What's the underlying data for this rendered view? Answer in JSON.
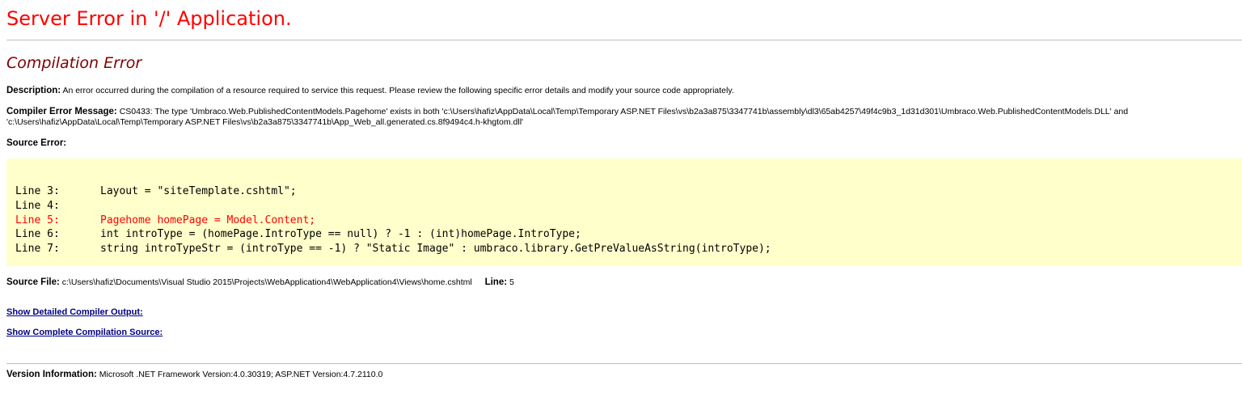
{
  "header": {
    "title": "Server Error in '/' Application."
  },
  "error": {
    "heading": "Compilation Error",
    "description_label": "Description:",
    "description_text": "An error occurred during the compilation of a resource required to service this request. Please review the following specific error details and modify your source code appropriately.",
    "compiler_message_label": "Compiler Error Message:",
    "compiler_message_text": "CS0433: The type 'Umbraco.Web.PublishedContentModels.Pagehome' exists in both 'c:\\Users\\hafiz\\AppData\\Local\\Temp\\Temporary ASP.NET Files\\vs\\b2a3a875\\3347741b\\assembly\\dl3\\65ab4257\\49f4c9b3_1d31d301\\Umbraco.Web.PublishedContentModels.DLL' and 'c:\\Users\\hafiz\\AppData\\Local\\Temp\\Temporary ASP.NET Files\\vs\\b2a3a875\\3347741b\\App_Web_all.generated.cs.8f9494c4.h-khgtom.dll'",
    "source_error_label": "Source Error:"
  },
  "source_code": {
    "lines": [
      {
        "number": "Line 3:",
        "code": "Layout = \"siteTemplate.cshtml\";"
      },
      {
        "number": "Line 4:",
        "code": ""
      },
      {
        "number": "Line 5:",
        "code": "Pagehome homePage = Model.Content;"
      },
      {
        "number": "Line 6:",
        "code": "int introType = (homePage.IntroType == null) ? -1 : (int)homePage.IntroType;"
      },
      {
        "number": "Line 7:",
        "code": "string introTypeStr = (introType == -1) ? \"Static Image\" : umbraco.library.GetPreValueAsString(introType);"
      }
    ],
    "highlight_line": "Line 5:",
    "highlight_color": "#ff0000",
    "background_color": "#ffffcc"
  },
  "source_file": {
    "label": "Source File:",
    "path": "c:\\Users\\hafiz\\Documents\\Visual Studio 2015\\Projects\\WebApplication4\\WebApplication4\\Views\\home.cshtml",
    "line_label": "Line:",
    "line_value": "5"
  },
  "links": {
    "detailed_output": "Show Detailed Compiler Output:",
    "complete_source": "Show Complete Compilation Source:"
  },
  "version": {
    "label": "Version Information:",
    "text": "Microsoft .NET Framework Version:4.0.30319; ASP.NET Version:4.7.2110.0"
  },
  "colors": {
    "title": "#ff0000",
    "heading": "#800000",
    "link": "#000080"
  }
}
